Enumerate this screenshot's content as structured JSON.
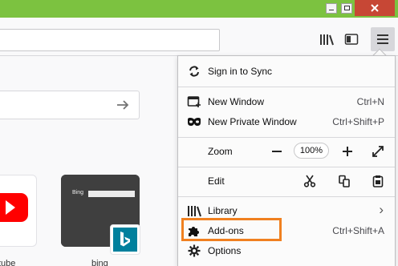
{
  "menu": {
    "sign_in": "Sign in to Sync",
    "new_window": {
      "label": "New Window",
      "shortcut": "Ctrl+N"
    },
    "new_private": {
      "label": "New Private Window",
      "shortcut": "Ctrl+Shift+P"
    },
    "zoom": {
      "label": "Zoom",
      "value": "100%",
      "minus": "−",
      "plus": "+"
    },
    "edit": {
      "label": "Edit"
    },
    "library": {
      "label": "Library",
      "chevron": "›"
    },
    "addons": {
      "label": "Add-ons",
      "shortcut": "Ctrl+Shift+A"
    },
    "options": {
      "label": "Options"
    }
  },
  "tiles": [
    {
      "label": "tube"
    },
    {
      "label": "bing"
    }
  ],
  "bing_thumb_text": "Bing",
  "icons": {
    "library": "library-icon",
    "sidebar": "sidebar-icon",
    "menu": "hamburger-menu-icon",
    "sync": "sync-icon",
    "new_window": "new-window-icon",
    "private": "private-mask-icon",
    "cut": "scissors-icon",
    "copy": "copy-icon",
    "paste": "paste-icon",
    "addons": "puzzle-icon",
    "options": "gear-icon"
  },
  "colors": {
    "titlebar": "#7cc240",
    "highlight": "#f08020",
    "close_button": "#c74735",
    "bing_teal": "#00809d",
    "youtube_red": "#ff0000"
  }
}
